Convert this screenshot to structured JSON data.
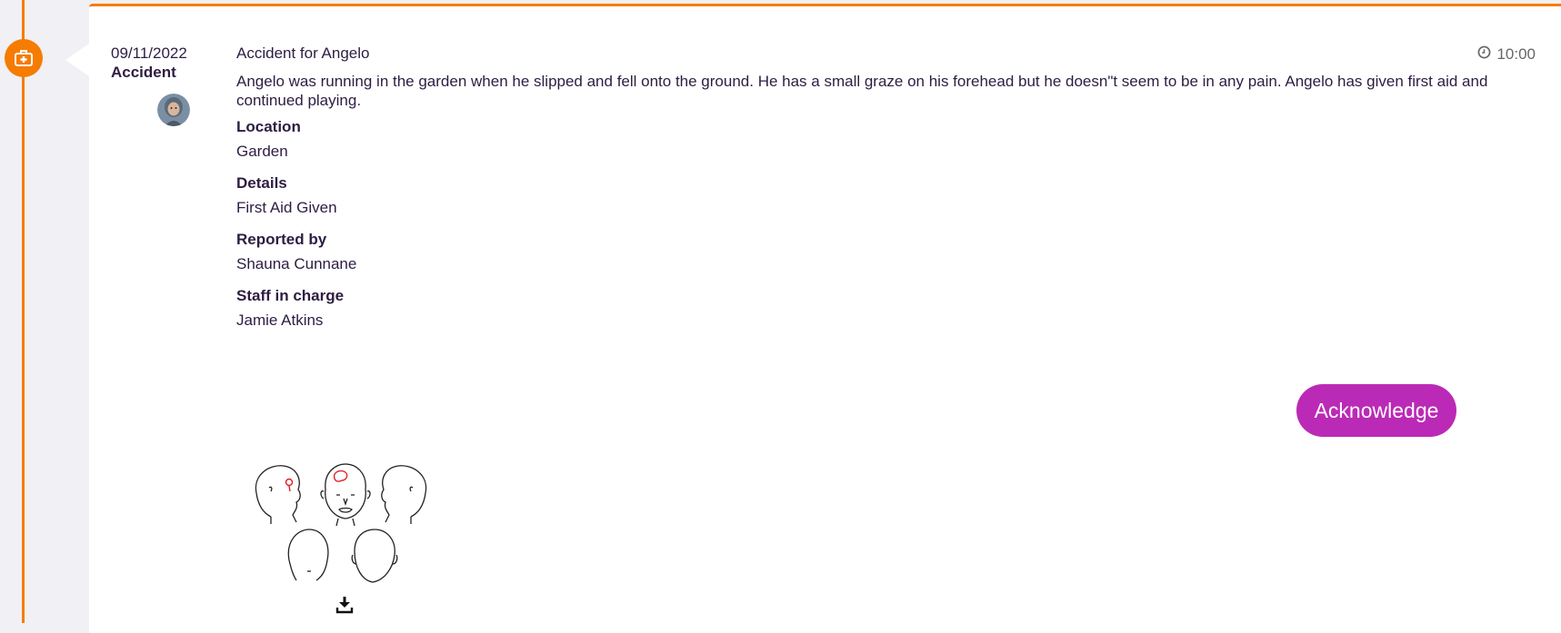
{
  "entry": {
    "date": "09/11/2022",
    "type": "Accident",
    "time": "10:00",
    "title": "Accident for Angelo",
    "description": "Angelo was running in the garden when he slipped and fell onto the ground. He has a small graze on his forehead but he doesn\"t seem to be in any pain. Angelo has given first aid and continued playing.",
    "fields": [
      {
        "label": "Location",
        "value": "Garden"
      },
      {
        "label": "Details",
        "value": "First Aid Given"
      },
      {
        "label": "Reported by",
        "value": "Shauna Cunnane"
      },
      {
        "label": "Staff in charge",
        "value": "Jamie Atkins"
      }
    ],
    "acknowledge_label": "Acknowledge"
  },
  "icons": {
    "timeline": "first-aid-kit-icon",
    "time": "clock-icon",
    "download": "download-icon"
  },
  "colors": {
    "accent": "#f57c00",
    "button": "#bb2ab6",
    "text": "#2d1d42",
    "background": "#f1f0f5"
  }
}
